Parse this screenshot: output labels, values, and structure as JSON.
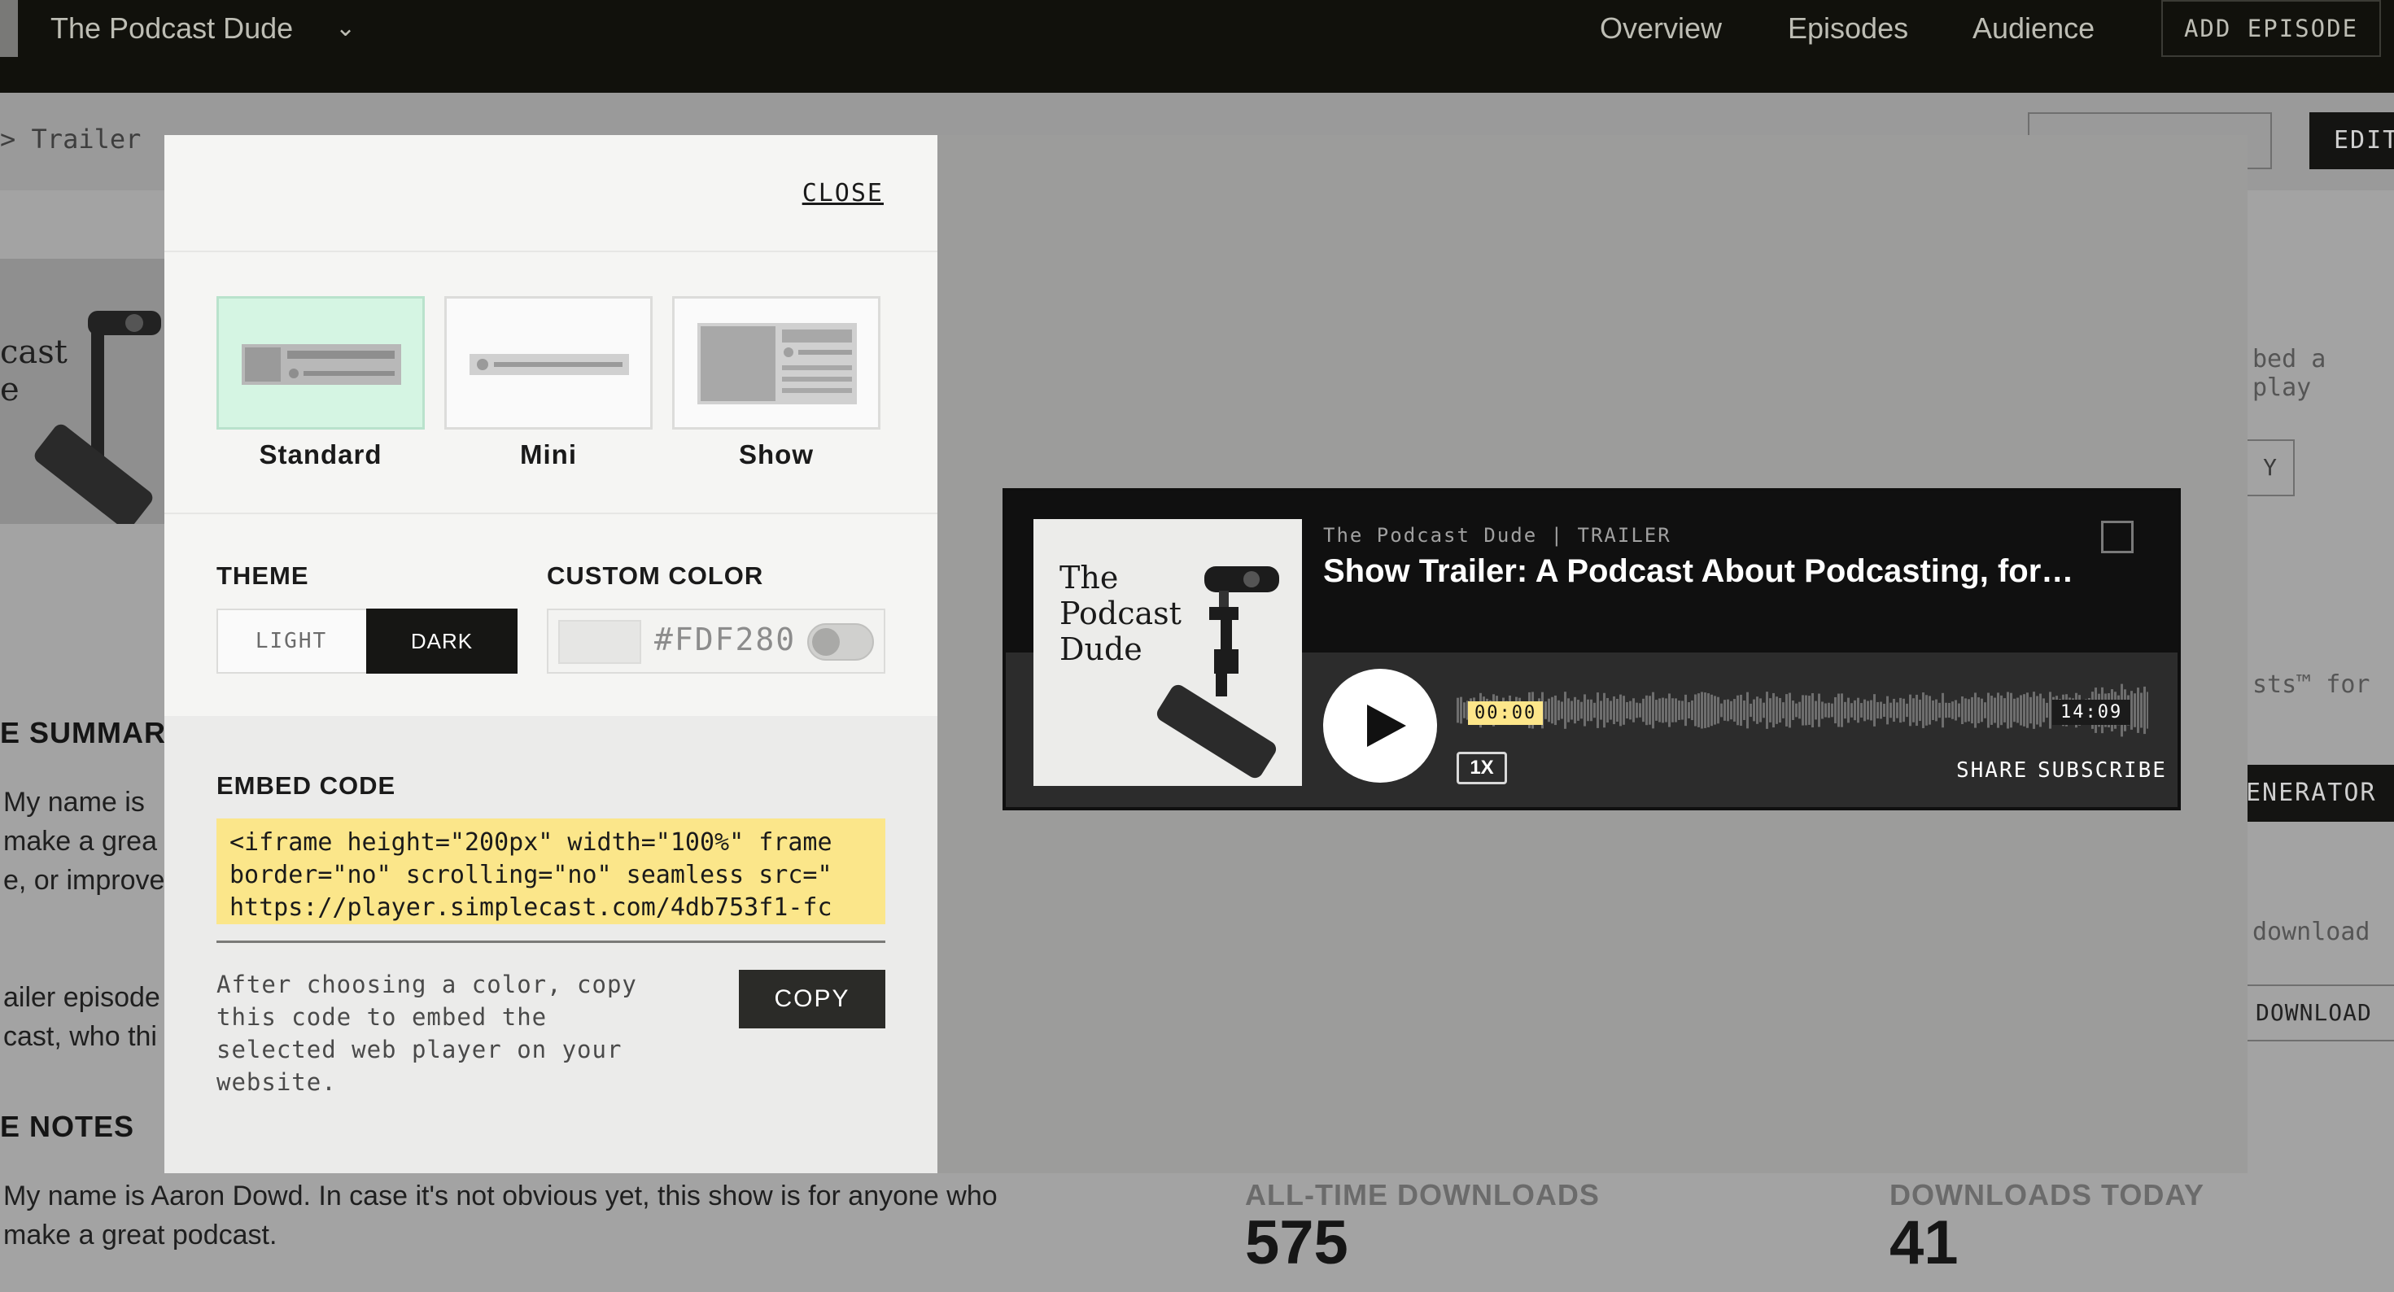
{
  "topbar": {
    "app_title": "The Podcast Dude",
    "nav": [
      "Overview",
      "Episodes",
      "Audience"
    ],
    "add_episode_label": "ADD EPISODE"
  },
  "background": {
    "breadcrumb": "> Trailer",
    "edit_label": "EDIT",
    "art_text_1": "cast",
    "art_text_2": "e",
    "summary_heading": "E SUMMARY",
    "summary_lines": [
      "My name is",
      "make a grea",
      "e, or improve"
    ],
    "trailer_lines": [
      "ailer episode",
      "cast, who thi"
    ],
    "notes_heading": "E NOTES",
    "notes_lines": [
      "My name is Aaron Dowd. In case it's not obvious yet, this show is for anyone who",
      "make a great podcast."
    ],
    "right_text_1": "bed a play",
    "copy_label": "Y",
    "right_text_2": "sts™ for",
    "generator_label": "ENERATOR",
    "right_text_3": "download",
    "download_label": "DOWNLOAD",
    "stats": {
      "all_time_label": "ALL-TIME DOWNLOADS",
      "all_time_value": "575",
      "today_label": "DOWNLOADS TODAY",
      "today_value": "41"
    }
  },
  "modal": {
    "close_label": "CLOSE",
    "player_styles": [
      {
        "label": "Standard",
        "selected": true
      },
      {
        "label": "Mini",
        "selected": false
      },
      {
        "label": "Show",
        "selected": false
      }
    ],
    "theme_label": "THEME",
    "theme_light": "LIGHT",
    "theme_dark": "DARK",
    "custom_color_label": "CUSTOM COLOR",
    "custom_color_value": "#FDF280",
    "custom_color_enabled": false,
    "embed_code_label": "EMBED CODE",
    "embed_code": "<iframe height=\"200px\" width=\"100%\" frame\nborder=\"no\" scrolling=\"no\" seamless src=\"\nhttps://player.simplecast.com/4db753f1-fc",
    "help_text": "After choosing a color, copy this code to embed the selected web player on your website.",
    "copy_label": "COPY"
  },
  "player": {
    "cover_title": "The Podcast Dude",
    "meta": "The Podcast Dude | TRAILER",
    "episode_title": "Show Trailer: A Podcast About Podcasting, for…",
    "time_start": "00:00",
    "time_end": "14:09",
    "speed": "1X",
    "share_label": "SHARE",
    "subscribe_label": "SUBSCRIBE",
    "colors": {
      "accent": "#fde68a",
      "selected_card": "#d5f5e3",
      "code_bg": "#fbe68a"
    }
  }
}
